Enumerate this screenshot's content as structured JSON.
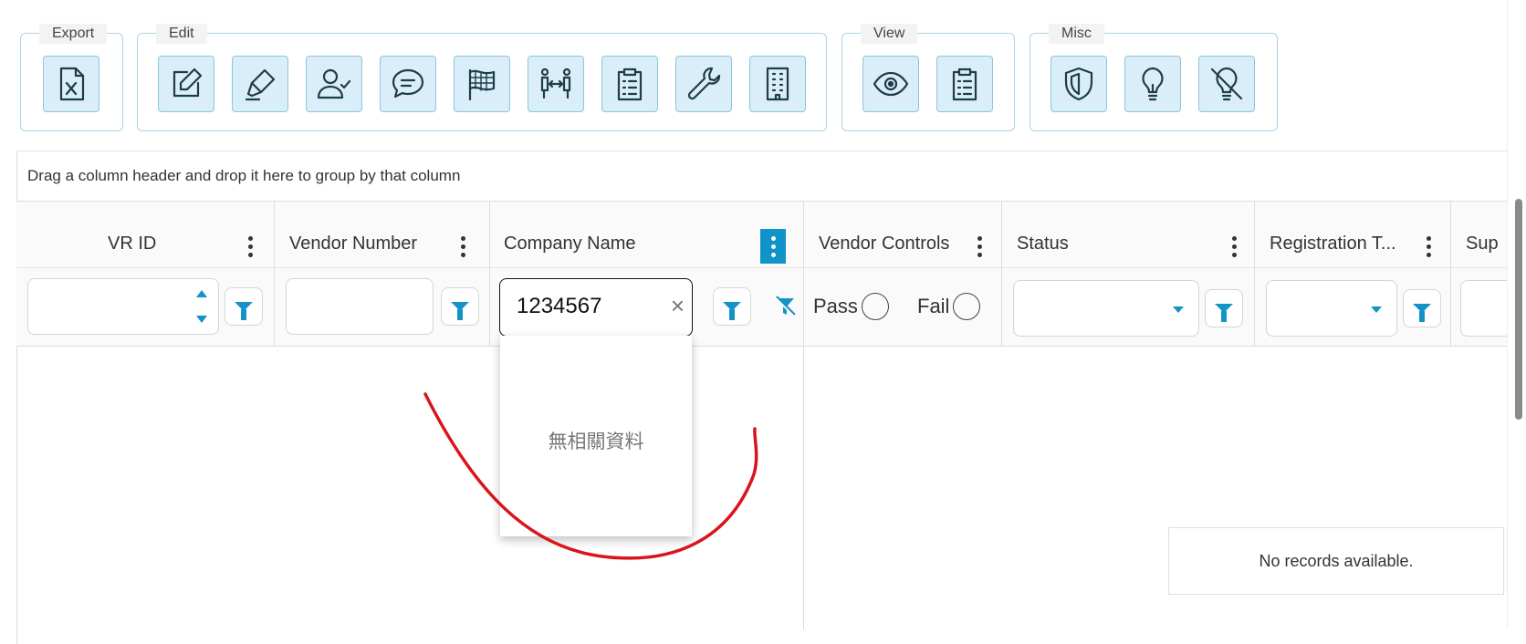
{
  "toolbar": {
    "export": {
      "label": "Export"
    },
    "edit": {
      "label": "Edit"
    },
    "view": {
      "label": "View"
    },
    "misc": {
      "label": "Misc"
    }
  },
  "grid": {
    "group_panel_text": "Drag a column header and drop it here to group by that column",
    "columns": [
      {
        "title": "VR ID"
      },
      {
        "title": "Vendor Number"
      },
      {
        "title": "Company Name"
      },
      {
        "title": "Vendor Controls"
      },
      {
        "title": "Status"
      },
      {
        "title": "Registration T..."
      },
      {
        "title": "Sup"
      }
    ],
    "filters": {
      "company_name_value": "1234567",
      "clear_glyph": "×",
      "pass_label": "Pass",
      "fail_label": "Fail"
    },
    "popup_text": "無相關資料",
    "no_records": "No records available."
  },
  "colors": {
    "accent": "#0f93c9",
    "toolbar_button_bg": "#d9eef8",
    "annotation": "#d9151b"
  },
  "icons": {
    "export": [
      "excel-file-icon"
    ],
    "edit": [
      "edit-icon",
      "highlighter-icon",
      "user-check-icon",
      "comment-icon",
      "checkered-flag-icon",
      "transfer-icon",
      "clipboard-list-icon",
      "wrench-icon",
      "building-icon"
    ],
    "view": [
      "eye-icon",
      "clipboard-list-icon"
    ],
    "misc": [
      "shield-icon",
      "lightbulb-icon",
      "lightbulb-off-icon"
    ]
  }
}
